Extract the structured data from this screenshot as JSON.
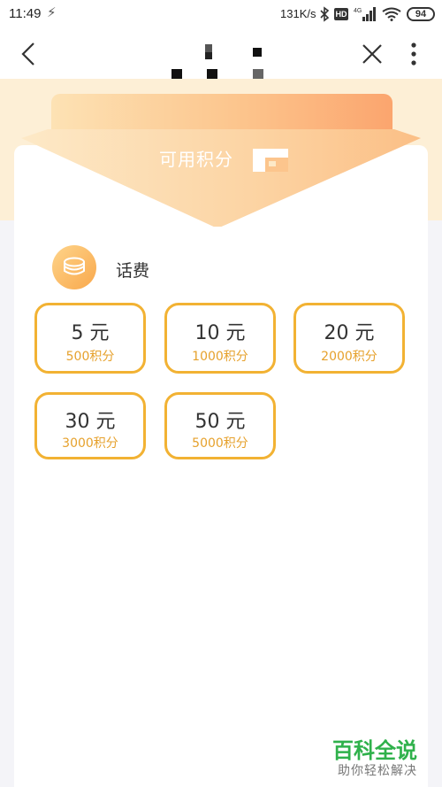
{
  "status_bar": {
    "time": "11:49",
    "network_speed": "131K/s",
    "hd_badge": "HD",
    "battery": "94"
  },
  "header": {
    "points_label": "可用积分"
  },
  "category": {
    "label": "话费"
  },
  "options": [
    {
      "amount": "5 元",
      "points": "500积分"
    },
    {
      "amount": "10 元",
      "points": "1000积分"
    },
    {
      "amount": "20 元",
      "points": "2000积分"
    },
    {
      "amount": "30 元",
      "points": "3000积分"
    },
    {
      "amount": "50 元",
      "points": "5000积分"
    }
  ],
  "watermark": {
    "title": "百科全说",
    "subtitle": "助你轻松解决"
  },
  "colors": {
    "accent": "#f2b233",
    "points_text": "#e6a12c",
    "band": "#fdefd6",
    "watermark": "#2fb14b"
  },
  "icons": [
    "flash-icon",
    "bluetooth-icon",
    "signal-icon",
    "wifi-icon",
    "battery-icon",
    "back-icon",
    "close-icon",
    "more-icon",
    "coins-icon"
  ]
}
